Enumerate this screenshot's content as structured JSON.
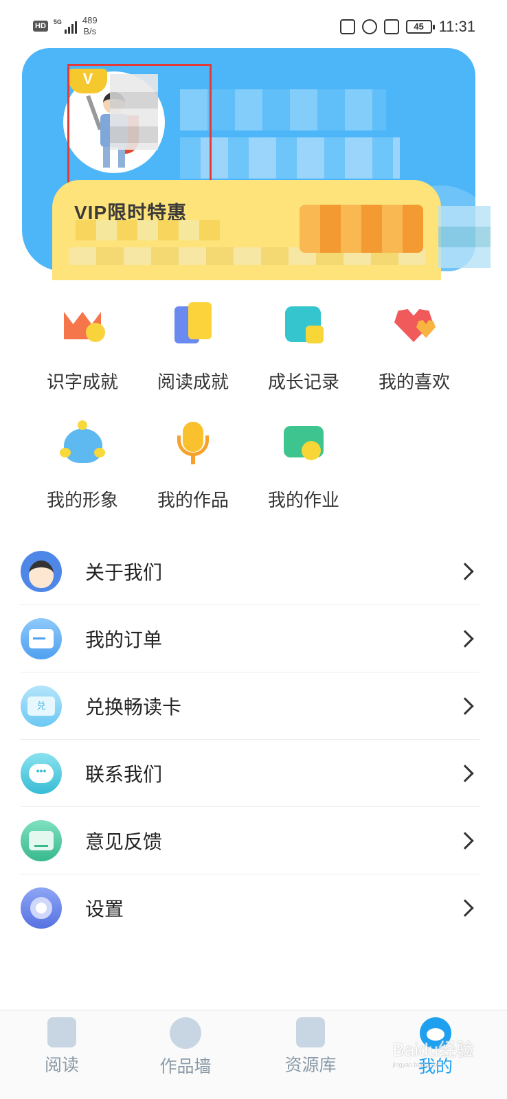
{
  "status_bar": {
    "hd": "HD",
    "network": "5G",
    "speed_value": "489",
    "speed_unit": "B/s",
    "battery": "45",
    "time": "11:31"
  },
  "header": {
    "vip_badge": "V",
    "vip_title": "VIP限时特惠"
  },
  "features": [
    {
      "label": "识字成就",
      "icon": "crown-icon"
    },
    {
      "label": "阅读成就",
      "icon": "book-icon"
    },
    {
      "label": "成长记录",
      "icon": "growth-chart-icon"
    },
    {
      "label": "我的喜欢",
      "icon": "heart-icon"
    },
    {
      "label": "我的形象",
      "icon": "avatar-character-icon"
    },
    {
      "label": "我的作品",
      "icon": "microphone-icon"
    },
    {
      "label": "我的作业",
      "icon": "homework-icon"
    }
  ],
  "menu": [
    {
      "label": "关于我们",
      "icon": "boy-face-icon"
    },
    {
      "label": "我的订单",
      "icon": "order-icon"
    },
    {
      "label": "兑换畅读卡",
      "icon": "ticket-icon",
      "icon_text": "兑"
    },
    {
      "label": "联系我们",
      "icon": "chat-bubble-icon",
      "icon_text": "•••"
    },
    {
      "label": "意见反馈",
      "icon": "feedback-icon"
    },
    {
      "label": "设置",
      "icon": "settings-gear-icon"
    }
  ],
  "tabbar": [
    {
      "label": "阅读",
      "icon": "reading-icon",
      "active": false
    },
    {
      "label": "作品墙",
      "icon": "works-wall-icon",
      "active": false
    },
    {
      "label": "资源库",
      "icon": "resource-library-icon",
      "active": false
    },
    {
      "label": "我的",
      "icon": "profile-icon",
      "active": true
    }
  ],
  "watermark": {
    "text": "Baidu经验",
    "sub": "jingyan.baidu.com"
  },
  "colors": {
    "banner": "#4db6f8",
    "vip_card": "#fde37a",
    "highlight": "#e53935",
    "active_tab": "#1ea0f0"
  }
}
